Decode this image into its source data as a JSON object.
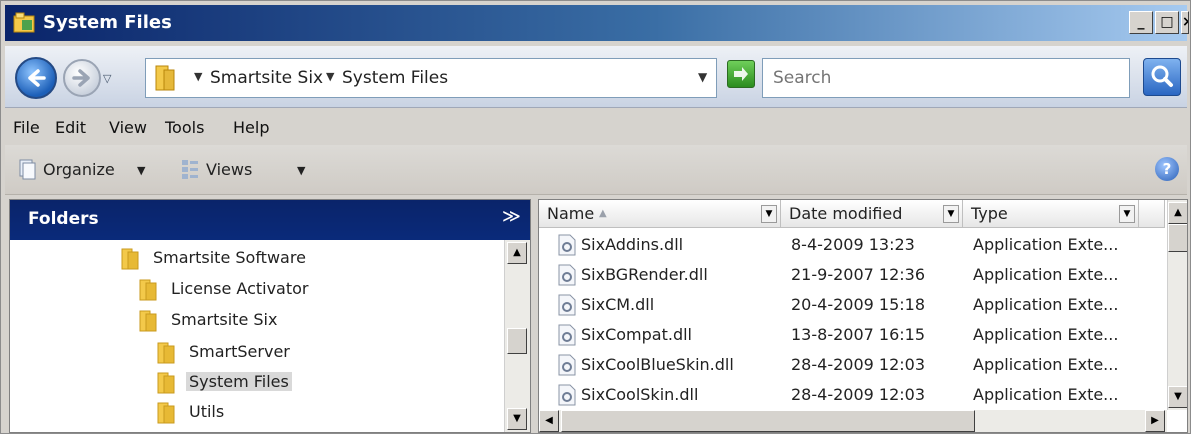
{
  "window": {
    "title": "System Files",
    "controls": {
      "minimize": "_",
      "maximize": "□",
      "close": "×"
    }
  },
  "address_bar": {
    "breadcrumbs": [
      "Smartsite Six",
      "System Files"
    ],
    "search_placeholder": "Search"
  },
  "menu": [
    "File",
    "Edit",
    "View",
    "Tools",
    "Help"
  ],
  "command_bar": {
    "organize": "Organize",
    "views": "Views",
    "help": "?"
  },
  "folders_pane": {
    "title": "Folders",
    "items": [
      {
        "label": "Smartsite Software",
        "selected": false
      },
      {
        "label": "License Activator",
        "selected": false
      },
      {
        "label": "Smartsite Six",
        "selected": false
      },
      {
        "label": "SmartServer",
        "selected": false
      },
      {
        "label": "System Files",
        "selected": true
      },
      {
        "label": "Utils",
        "selected": false
      }
    ]
  },
  "file_list": {
    "columns": [
      "Name",
      "Date modified",
      "Type"
    ],
    "rows": [
      {
        "name": "SixAddins.dll",
        "date": "8-4-2009 13:23",
        "type": "Application Exte..."
      },
      {
        "name": "SixBGRender.dll",
        "date": "21-9-2007 12:36",
        "type": "Application Exte..."
      },
      {
        "name": "SixCM.dll",
        "date": "20-4-2009 15:18",
        "type": "Application Exte..."
      },
      {
        "name": "SixCompat.dll",
        "date": "13-8-2007 16:15",
        "type": "Application Exte..."
      },
      {
        "name": "SixCoolBlueSkin.dll",
        "date": "28-4-2009 12:03",
        "type": "Application Exte..."
      },
      {
        "name": "SixCoolSkin.dll",
        "date": "28-4-2009 12:03",
        "type": "Application Exte..."
      }
    ]
  },
  "colors": {
    "titlebar_start": "#0a246a",
    "titlebar_end": "#a6caf0",
    "folder_yellow": "#f3c94a",
    "selection": "#d9d9d9"
  }
}
